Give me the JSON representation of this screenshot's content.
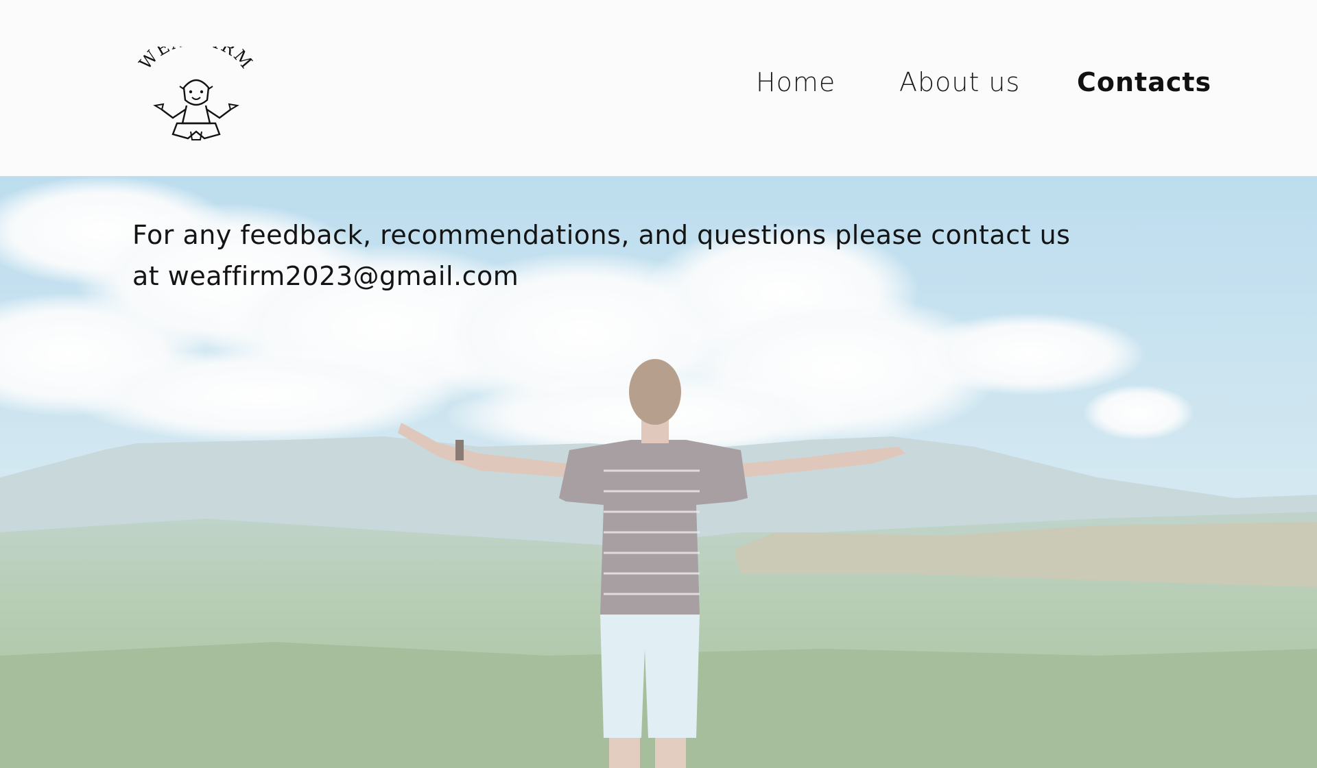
{
  "brand": {
    "name": "WEAFFIRM",
    "logo_icon": "meditating-figure-icon"
  },
  "nav": {
    "items": [
      {
        "label": "Home",
        "active": false
      },
      {
        "label": "About us",
        "active": false
      },
      {
        "label": "Contacts",
        "active": true
      }
    ]
  },
  "hero": {
    "background": "person-arms-outstretched-mountain-landscape",
    "message": "For any feedback, recommendations, and questions please contact us at weaffirm2023@gmail.com"
  },
  "colors": {
    "header_bg": "#fcfbfc",
    "text": "#141414",
    "sky": "#a9d3e8",
    "valley": "#8fb08a"
  }
}
